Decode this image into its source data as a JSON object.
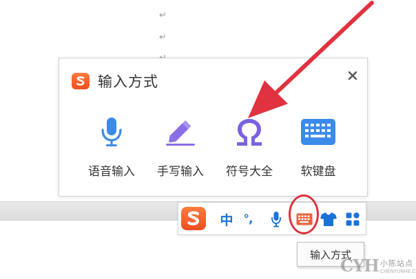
{
  "document": {
    "paragraph_mark": "↵"
  },
  "popup": {
    "title": "输入方式",
    "logo_letter": "S",
    "close_label": "×",
    "options": [
      {
        "label": "语音输入",
        "icon": "microphone-icon"
      },
      {
        "label": "手写输入",
        "icon": "pencil-icon"
      },
      {
        "label": "符号大全",
        "icon": "omega-icon"
      },
      {
        "label": "软键盘",
        "icon": "keyboard-icon"
      }
    ]
  },
  "toolbar": {
    "logo_letter": "S",
    "chinese_mode": "中",
    "punctuation": "°,",
    "items": [
      "microphone-icon",
      "keyboard-icon",
      "shirt-icon",
      "apps-grid-icon"
    ]
  },
  "tooltip": {
    "text": "输入方式"
  },
  "watermark": {
    "logo": "CYH",
    "title": "小陈站点",
    "subtitle": "CHENYUNHE.COM"
  },
  "colors": {
    "brand_orange": "#f04e1f",
    "icon_blue": "#3d8be8",
    "icon_purple": "#8a6ee6",
    "annotation_red": "#e0323f"
  }
}
